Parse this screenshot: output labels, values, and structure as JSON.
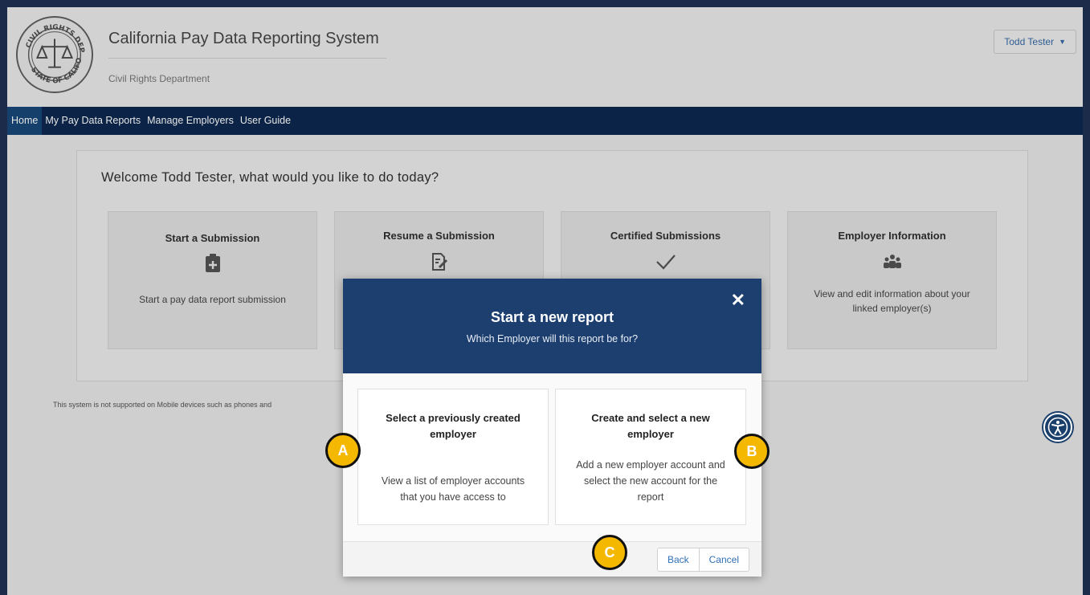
{
  "header": {
    "title": "California Pay Data Reporting System",
    "subtitle": "Civil Rights Department",
    "user_menu": "Todd Tester"
  },
  "nav": {
    "items": [
      "Home",
      "My Pay Data Reports",
      "Manage Employers",
      "User Guide"
    ],
    "active": "Home"
  },
  "welcome": {
    "heading": "Welcome Todd Tester, what would you like to do today?",
    "cards": [
      {
        "title": "Start a Submission",
        "icon": "clipboard-plus-icon",
        "desc": "Start a pay data report submission"
      },
      {
        "title": "Resume a Submission",
        "icon": "edit-document-icon",
        "desc": ""
      },
      {
        "title": "Certified Submissions",
        "icon": "checkmark-icon",
        "desc": ""
      },
      {
        "title": "Employer Information",
        "icon": "people-group-icon",
        "desc": "View and edit information about your linked employer(s)"
      }
    ]
  },
  "mobile_note": "This system is not supported on Mobile devices such as phones and",
  "modal": {
    "title": "Start a new report",
    "subtitle": "Which Employer will this report be for?",
    "options": [
      {
        "title": "Select a previously created employer",
        "desc": "View a list of employer accounts that you have access to"
      },
      {
        "title": "Create and select a new employer",
        "desc": "Add a new employer account and select the new account for the report"
      }
    ],
    "back_label": "Back",
    "cancel_label": "Cancel"
  },
  "markers": {
    "a": "A",
    "b": "B",
    "c": "C"
  },
  "colors": {
    "nav": "#0a2346",
    "modal_header": "#1c3f70",
    "marker": "#f5b800",
    "link": "#2f6fb5"
  }
}
